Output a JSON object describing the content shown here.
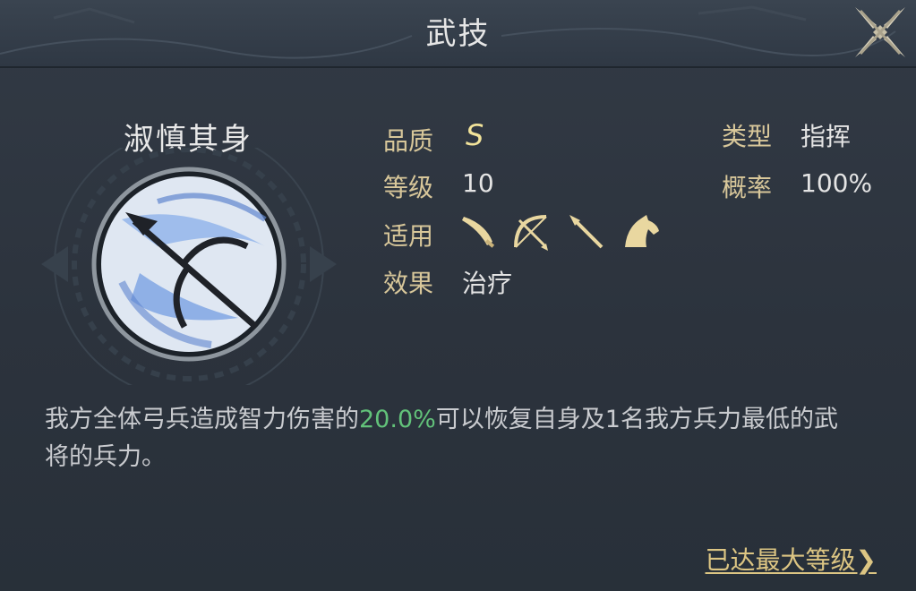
{
  "header": {
    "title": "武技"
  },
  "skill": {
    "name": "淑慎其身",
    "quality_label": "品质",
    "quality_value": "S",
    "level_label": "等级",
    "level_value": "10",
    "applicable_label": "适用",
    "applicable_icons": [
      "saber-icon",
      "bow-icon",
      "spear-icon",
      "horse-icon"
    ],
    "effect_label": "效果",
    "effect_value": "治疗",
    "type_label": "类型",
    "type_value": "指挥",
    "rate_label": "概率",
    "rate_value": "100%"
  },
  "description": {
    "part1": "我方全体弓兵造成智力伤害的",
    "highlight": "20.0%",
    "part2": "可以恢复自身及1名我方兵力最低的武将的兵力。"
  },
  "footer": {
    "max_level_label": "已达最大等级",
    "max_level_arrow": "❯"
  },
  "colors": {
    "background": "#2d3540",
    "label": "#d8c79a",
    "value": "#e4e4e4",
    "highlight": "#62c27a",
    "link": "#dcc583"
  }
}
